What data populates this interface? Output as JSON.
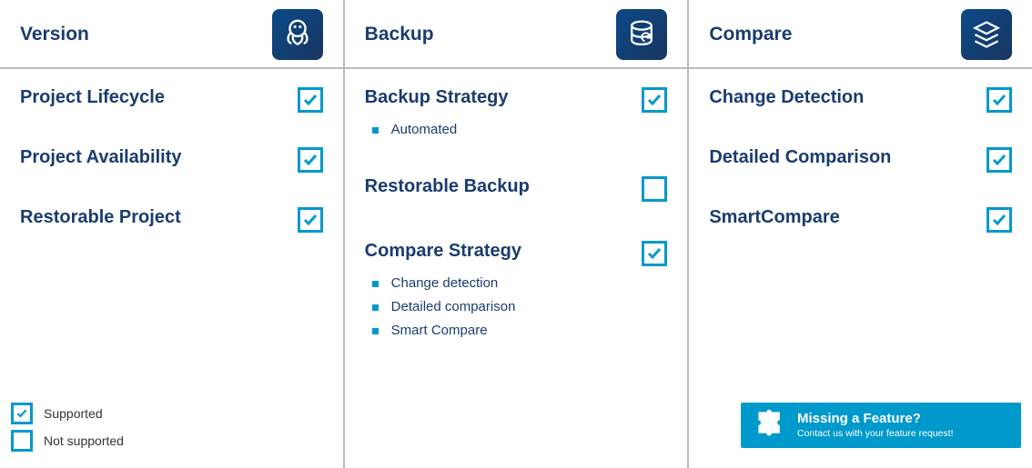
{
  "columns": [
    {
      "title": "Version",
      "icon": "octopus",
      "items": [
        {
          "label": "Project Lifecycle",
          "checked": true
        },
        {
          "label": "Project Availability",
          "checked": true
        },
        {
          "label": "Restorable Project",
          "checked": true
        }
      ]
    },
    {
      "title": "Backup",
      "icon": "database",
      "items": [
        {
          "label": "Backup Strategy",
          "checked": true,
          "subs": [
            "Automated"
          ]
        },
        {
          "label": "Restorable Backup",
          "checked": false
        },
        {
          "label": "Compare Strategy",
          "checked": true,
          "subs": [
            "Change detection",
            "Detailed comparison",
            "Smart Compare"
          ]
        }
      ]
    },
    {
      "title": "Compare",
      "icon": "layers",
      "items": [
        {
          "label": "Change Detection",
          "checked": true
        },
        {
          "label": "Detailed Comparison",
          "checked": true
        },
        {
          "label": "SmartCompare",
          "checked": true
        }
      ]
    }
  ],
  "legend": {
    "supported": "Supported",
    "notsupported": "Not supported"
  },
  "banner": {
    "title": "Missing a Feature?",
    "sub": "Contact us with your feature request!"
  },
  "colors": {
    "cyan": "#0099cc",
    "navy": "#1a3c6e"
  }
}
